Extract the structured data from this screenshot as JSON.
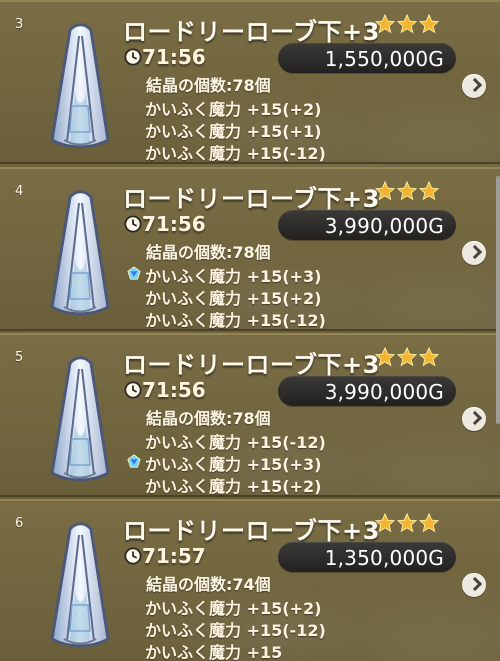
{
  "list": {
    "rows": [
      {
        "index": "3",
        "name": "ロードリーローブ下+3",
        "time": "71:56",
        "price": "1,550,000G",
        "crystal": "結晶の個数:78個",
        "stats": [
          {
            "text": "かいふく魔力 +15(+2)",
            "gem": false
          },
          {
            "text": "かいふく魔力 +15(+1)",
            "gem": false
          },
          {
            "text": "かいふく魔力 +15(-12)",
            "gem": false
          }
        ]
      },
      {
        "index": "4",
        "name": "ロードリーローブ下+3",
        "time": "71:56",
        "price": "3,990,000G",
        "crystal": "結晶の個数:78個",
        "stats": [
          {
            "text": "かいふく魔力 +15(+3)",
            "gem": true
          },
          {
            "text": "かいふく魔力 +15(+2)",
            "gem": false
          },
          {
            "text": "かいふく魔力 +15(-12)",
            "gem": false
          }
        ]
      },
      {
        "index": "5",
        "name": "ロードリーローブ下+3",
        "time": "71:56",
        "price": "3,990,000G",
        "crystal": "結晶の個数:78個",
        "stats": [
          {
            "text": "かいふく魔力 +15(-12)",
            "gem": false
          },
          {
            "text": "かいふく魔力 +15(+3)",
            "gem": true
          },
          {
            "text": "かいふく魔力 +15(+2)",
            "gem": false
          }
        ]
      },
      {
        "index": "6",
        "name": "ロードリーローブ下+3",
        "time": "71:57",
        "price": "1,350,000G",
        "crystal": "結晶の個数:74個",
        "stats": [
          {
            "text": "かいふく魔力 +15(+2)",
            "gem": false
          },
          {
            "text": "かいふく魔力 +15(-12)",
            "gem": false
          },
          {
            "text": "かいふく魔力 +15",
            "gem": false
          }
        ]
      }
    ]
  },
  "icons": {
    "item": "robe-icon",
    "star": "star-icon",
    "clock": "clock-icon",
    "gem": "gem-icon",
    "arrow": "chevron-right-icon"
  },
  "colors": {
    "background": "#6b6039",
    "row": "#76693f",
    "text": "#fff7e6",
    "price_pill": "#2a2927",
    "star": "#f3b531"
  }
}
